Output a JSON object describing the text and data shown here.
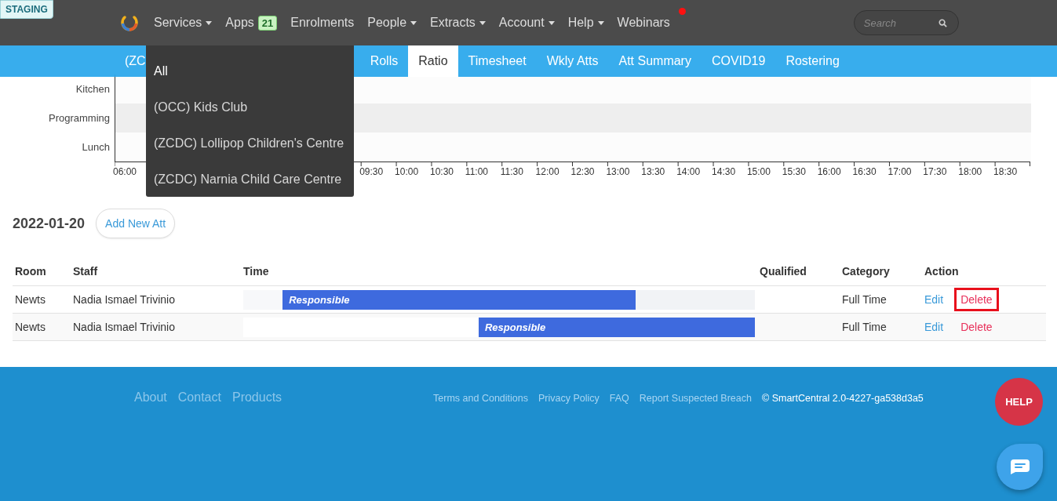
{
  "environment_badge": "STAGING",
  "nav": {
    "items": [
      {
        "label": "Services",
        "caret": true
      },
      {
        "label": "Apps",
        "caret": false,
        "badge": "21"
      },
      {
        "label": "Enrolments",
        "caret": false
      },
      {
        "label": "People",
        "caret": true
      },
      {
        "label": "Extracts",
        "caret": true
      },
      {
        "label": "Account",
        "caret": true
      },
      {
        "label": "Help",
        "caret": true
      },
      {
        "label": "Webinars",
        "caret": false,
        "notify": true
      }
    ],
    "search": {
      "placeholder": "Search"
    }
  },
  "subnav": {
    "tabs": [
      {
        "label": "(ZC",
        "selected": false
      },
      {
        "label": "Rolls",
        "selected": false
      },
      {
        "label": "Ratio",
        "selected": true
      },
      {
        "label": "Timesheet",
        "selected": false
      },
      {
        "label": "Wkly Atts",
        "selected": false
      },
      {
        "label": "Att Summary",
        "selected": false
      },
      {
        "label": "COVID19",
        "selected": false
      },
      {
        "label": "Rostering",
        "selected": false
      }
    ]
  },
  "services_menu": {
    "items": [
      {
        "label": "All",
        "selected": true
      },
      {
        "label": "(OCC) Kids Club",
        "selected": false
      },
      {
        "label": "(ZCDC) Lollipop Children's Centre",
        "selected": false
      },
      {
        "label": "(ZCDC) Narnia Child Care Centre",
        "selected": false
      }
    ]
  },
  "timeline": {
    "rows": [
      "Kitchen",
      "Programming",
      "Lunch"
    ],
    "ticks": [
      "06:00",
      "09:30",
      "10:00",
      "10:30",
      "11:00",
      "11:30",
      "12:00",
      "12:30",
      "13:00",
      "13:30",
      "14:00",
      "14:30",
      "15:00",
      "15:30",
      "16:00",
      "16:30",
      "17:00",
      "17:30",
      "18:00",
      "18:30"
    ]
  },
  "date": "2022-01-20",
  "add_button": "Add New Att",
  "table": {
    "columns": [
      "Room",
      "Staff",
      "Time",
      "Qualified",
      "Category",
      "Action"
    ],
    "rows": [
      {
        "room": "Newts",
        "staff": "Nadia Ismael Trivinio",
        "segments": [
          {
            "kind": "space",
            "level": 0.077
          },
          {
            "kind": "shift",
            "label": "Responsible",
            "level": 0.748
          }
        ],
        "category": "Full Time",
        "edit": "Edit",
        "delete": "Delete",
        "delete_focused": true
      },
      {
        "room": "Newts",
        "staff": "Nadia Ismael Trivinio",
        "segments": [
          {
            "kind": "blank",
            "level": 0.46
          },
          {
            "kind": "shift",
            "label": "Responsible",
            "level": 1
          }
        ],
        "category": "Full Time",
        "edit": "Edit",
        "delete": "Delete",
        "delete_focused": false
      }
    ]
  },
  "footer": {
    "links": [
      "About",
      "Contact",
      "Products"
    ],
    "legal_links": [
      "Terms and Conditions",
      "Privacy Policy",
      "FAQ",
      "Report Suspected Breach"
    ],
    "copyright": "© SmartCentral 2.0-4227-ga538d3a5"
  },
  "help_button": "HELP"
}
